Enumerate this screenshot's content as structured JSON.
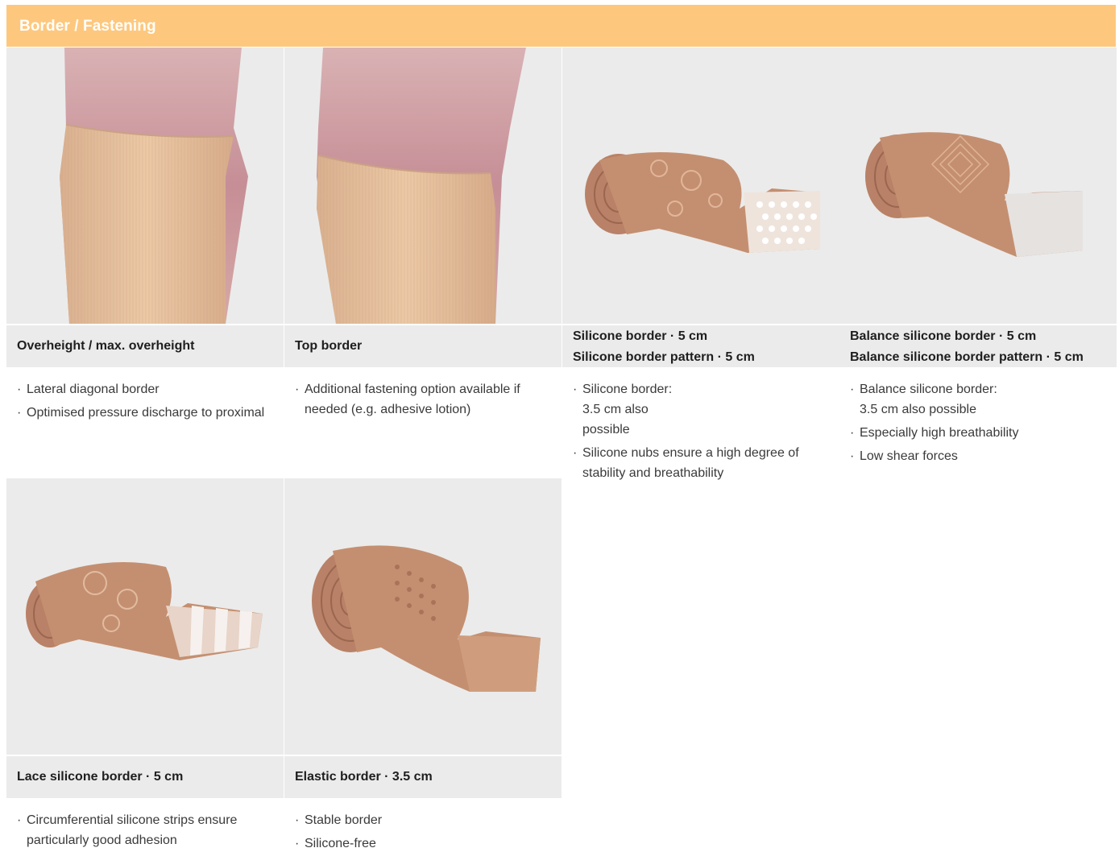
{
  "header": {
    "title": "Border / Fastening"
  },
  "cards": [
    {
      "title_lines": [
        "Overheight / max. overheight"
      ],
      "image": "knee-stocking-diagonal-border-image",
      "bullets": [
        "Lateral diagonal border",
        "Optimised pressure discharge to proximal"
      ]
    },
    {
      "title_lines": [
        "Top border"
      ],
      "image": "knee-stocking-top-border-image",
      "bullets": [
        "Additional fastening option available if needed (e.g. adhesive lotion)"
      ]
    },
    {
      "title_lines": [
        "Silicone border · 5 cm",
        "Silicone border pattern · 5 cm"
      ],
      "image": "silicone-border-roll-image",
      "bullets": [
        "Silicone border: 3.5 cm also possible",
        "Silicone nubs ensure a high degree of stability and breathability"
      ]
    },
    {
      "title_lines": [
        "Balance silicone border · 5 cm",
        "Balance silicone border pattern · 5 cm"
      ],
      "image": "balance-silicone-border-roll-image",
      "bullets": [
        "Balance silicone border: 3.5 cm also possible",
        "Especially high breathability",
        "Low shear forces"
      ]
    },
    {
      "title_lines": [
        "Lace silicone border · 5 cm"
      ],
      "image": "lace-silicone-border-roll-image",
      "bullets": [
        "Circumferential silicone strips ensure particularly good adhesion"
      ]
    },
    {
      "title_lines": [
        "Elastic border · 3.5 cm"
      ],
      "image": "elastic-border-roll-image",
      "bullets": [
        "Stable border",
        "Silicone-free"
      ]
    }
  ],
  "bullet_marker": "·",
  "colors": {
    "header": "#fdc87e",
    "panel": "#ebebeb",
    "skin": "#d9a8a8",
    "stocking": "#e8c09a",
    "band": "#c48f70"
  }
}
